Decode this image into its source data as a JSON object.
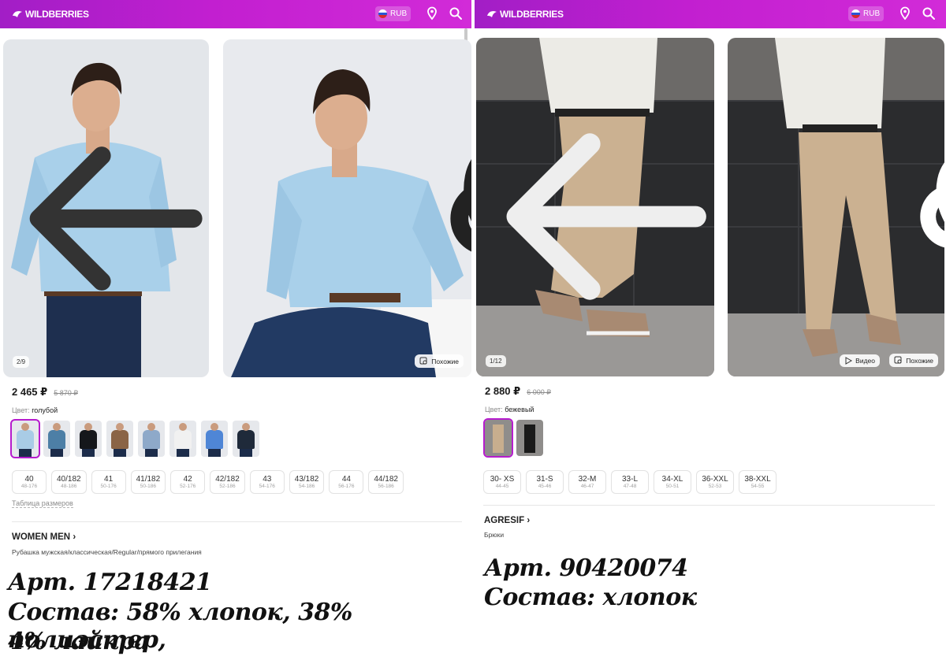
{
  "header": {
    "logo_text": "WILDBERRIES",
    "currency": "RUB"
  },
  "left": {
    "photo_counter": "2/9",
    "similar_label": "Похожие",
    "price": "2 465 ₽",
    "old_price": "5 870 ₽",
    "color_label": "Цвет:",
    "color_value": "голубой",
    "swatches": [
      "#a9cce6",
      "#4d7fa6",
      "#15171b",
      "#8a6446",
      "#8ea9c9",
      "#f1f1f1",
      "#4f86d6",
      "#1f2a3a"
    ],
    "sizes": [
      {
        "size": "40",
        "hint": "48-176"
      },
      {
        "size": "40/182",
        "hint": "48-186"
      },
      {
        "size": "41",
        "hint": "50-176"
      },
      {
        "size": "41/182",
        "hint": "50-186"
      },
      {
        "size": "42",
        "hint": "52-176"
      },
      {
        "size": "42/182",
        "hint": "52-186"
      },
      {
        "size": "43",
        "hint": "54-176"
      },
      {
        "size": "43/182",
        "hint": "54-186"
      },
      {
        "size": "44",
        "hint": "56-176"
      },
      {
        "size": "44/182",
        "hint": "56-186"
      }
    ],
    "size_table": "Таблица размеров",
    "brand": "WOMEN MEN",
    "product_title": "Рубашка мужская/классическая/Regular/прямого прилегания",
    "note_article": "Арт. 17218421",
    "note_composition_1": "Состав: 58% хлопок, 38% полиэстер,",
    "note_composition_2": "4% лайкра"
  },
  "right": {
    "photo_counter": "1/12",
    "video_label": "Видео",
    "similar_label": "Похожие",
    "price": "2 880 ₽",
    "old_price": "6 000 ₽",
    "color_label": "Цвет:",
    "color_value": "бежевый",
    "swatches": [
      "#c8ae8e",
      "#1a1a1a"
    ],
    "sizes": [
      {
        "size": "30- XS",
        "hint": "44-45"
      },
      {
        "size": "31-S",
        "hint": "45-46"
      },
      {
        "size": "32-M",
        "hint": "46-47"
      },
      {
        "size": "33-L",
        "hint": "47-48"
      },
      {
        "size": "34-XL",
        "hint": "50-51"
      },
      {
        "size": "36-XXL",
        "hint": "52-53"
      },
      {
        "size": "38-XXL",
        "hint": "54-55"
      }
    ],
    "brand": "AGRESIF",
    "product_title": "Брюки",
    "note_article": "Арт. 90420074",
    "note_composition": "Состав: хлопок"
  }
}
